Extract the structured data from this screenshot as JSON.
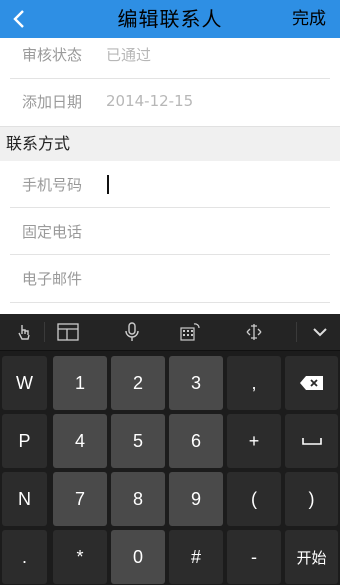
{
  "header": {
    "title": "编辑联系人",
    "done_label": "完成"
  },
  "info_rows": [
    {
      "label": "审核状态",
      "value": "已通过"
    },
    {
      "label": "添加日期",
      "value": "2014-12-15"
    }
  ],
  "contact_section": {
    "title": "联系方式"
  },
  "contact_fields": [
    {
      "label": "手机号码",
      "value": ""
    },
    {
      "label": "固定电话",
      "value": ""
    },
    {
      "label": "电子邮件",
      "value": ""
    }
  ],
  "keyboard": {
    "toolbar_icons": [
      "touch-icon",
      "layout-icon",
      "mic-icon",
      "keypad-icon",
      "cursor-move-icon",
      "collapse-icon"
    ],
    "rows": [
      [
        "W",
        "1",
        "2",
        "3",
        ",",
        "backspace-icon"
      ],
      [
        "P",
        "4",
        "5",
        "6",
        "+",
        "space-icon"
      ],
      [
        "N",
        "7",
        "8",
        "9",
        "(",
        ")"
      ],
      [
        ".",
        "*",
        "0",
        "#",
        "-",
        "开始"
      ]
    ]
  }
}
